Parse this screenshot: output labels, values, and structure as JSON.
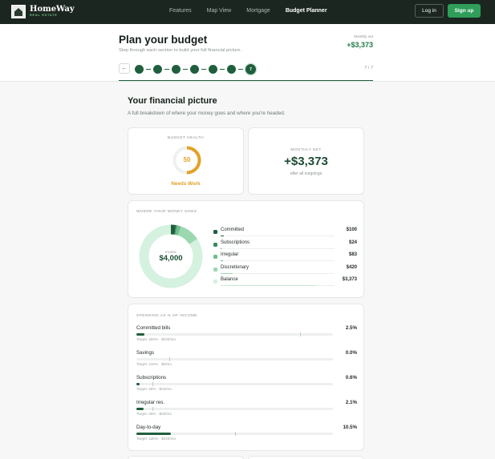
{
  "nav": {
    "brand_name": "HomeWay",
    "brand_sub": "REAL ESTATE",
    "links": [
      {
        "label": "Features",
        "active": false
      },
      {
        "label": "Map View",
        "active": false
      },
      {
        "label": "Mortgage",
        "active": false
      },
      {
        "label": "Budget Planner",
        "active": true
      }
    ],
    "login_label": "Log in",
    "signup_label": "Sign up"
  },
  "header": {
    "title": "Plan your budget",
    "subtitle": "Step through each section to build your full financial picture.",
    "net_label": "Monthly net",
    "net_value": "+$3,373",
    "back_icon": "arrow-left-icon",
    "current_step": "7",
    "step_count": "7 / 7",
    "steps_total": 7,
    "progress": 1.0
  },
  "section": {
    "title": "Your financial picture",
    "subtitle": "A full breakdown of where your money goes and where you're headed."
  },
  "health": {
    "label": "BUDGET HEALTH",
    "score": "50",
    "score_value": 50,
    "status": "Needs Work",
    "color": "#e3a126"
  },
  "monthly_net": {
    "label": "MONTHLY NET",
    "value": "+$3,373",
    "note": "after all outgoings"
  },
  "money": {
    "label": "WHERE YOUR MONEY GOES",
    "center_label": "Income",
    "center_value": "$4,000",
    "income": 4000,
    "items": [
      {
        "name": "Committed",
        "amount": "$100",
        "value": 100,
        "color": "#1f5f3d"
      },
      {
        "name": "Subscriptions",
        "amount": "$24",
        "value": 24,
        "color": "#3a8a5a"
      },
      {
        "name": "Irregular",
        "amount": "$83",
        "value": 83,
        "color": "#6cbf8a"
      },
      {
        "name": "Discretionary",
        "amount": "$420",
        "value": 420,
        "color": "#9bd8b0"
      },
      {
        "name": "Balance",
        "amount": "$3,373",
        "value": 3373,
        "color": "#d5f1df"
      }
    ]
  },
  "spending": {
    "label": "SPENDING AS % OF INCOME",
    "rows": [
      {
        "name": "Committed bills",
        "pct": "2.5%",
        "value": 2.5,
        "target_value": 50,
        "target": "Target: ≤50% · $100/mo"
      },
      {
        "name": "Savings",
        "pct": "0.0%",
        "value": 0.0,
        "target_value": 10,
        "target": "Target: ≥10% · $0/mo"
      },
      {
        "name": "Subscriptions",
        "pct": "0.6%",
        "value": 0.6,
        "target_value": 5,
        "target": "Target: ≤5% · $24/mo"
      },
      {
        "name": "Irregular res.",
        "pct": "2.1%",
        "value": 2.1,
        "target_value": 5,
        "target": "Target: ≤5% · $83/mo"
      },
      {
        "name": "Day-to-day",
        "pct": "10.5%",
        "value": 10.5,
        "target_value": 30,
        "target": "Target: ≤30% · $420/mo"
      }
    ]
  }
}
